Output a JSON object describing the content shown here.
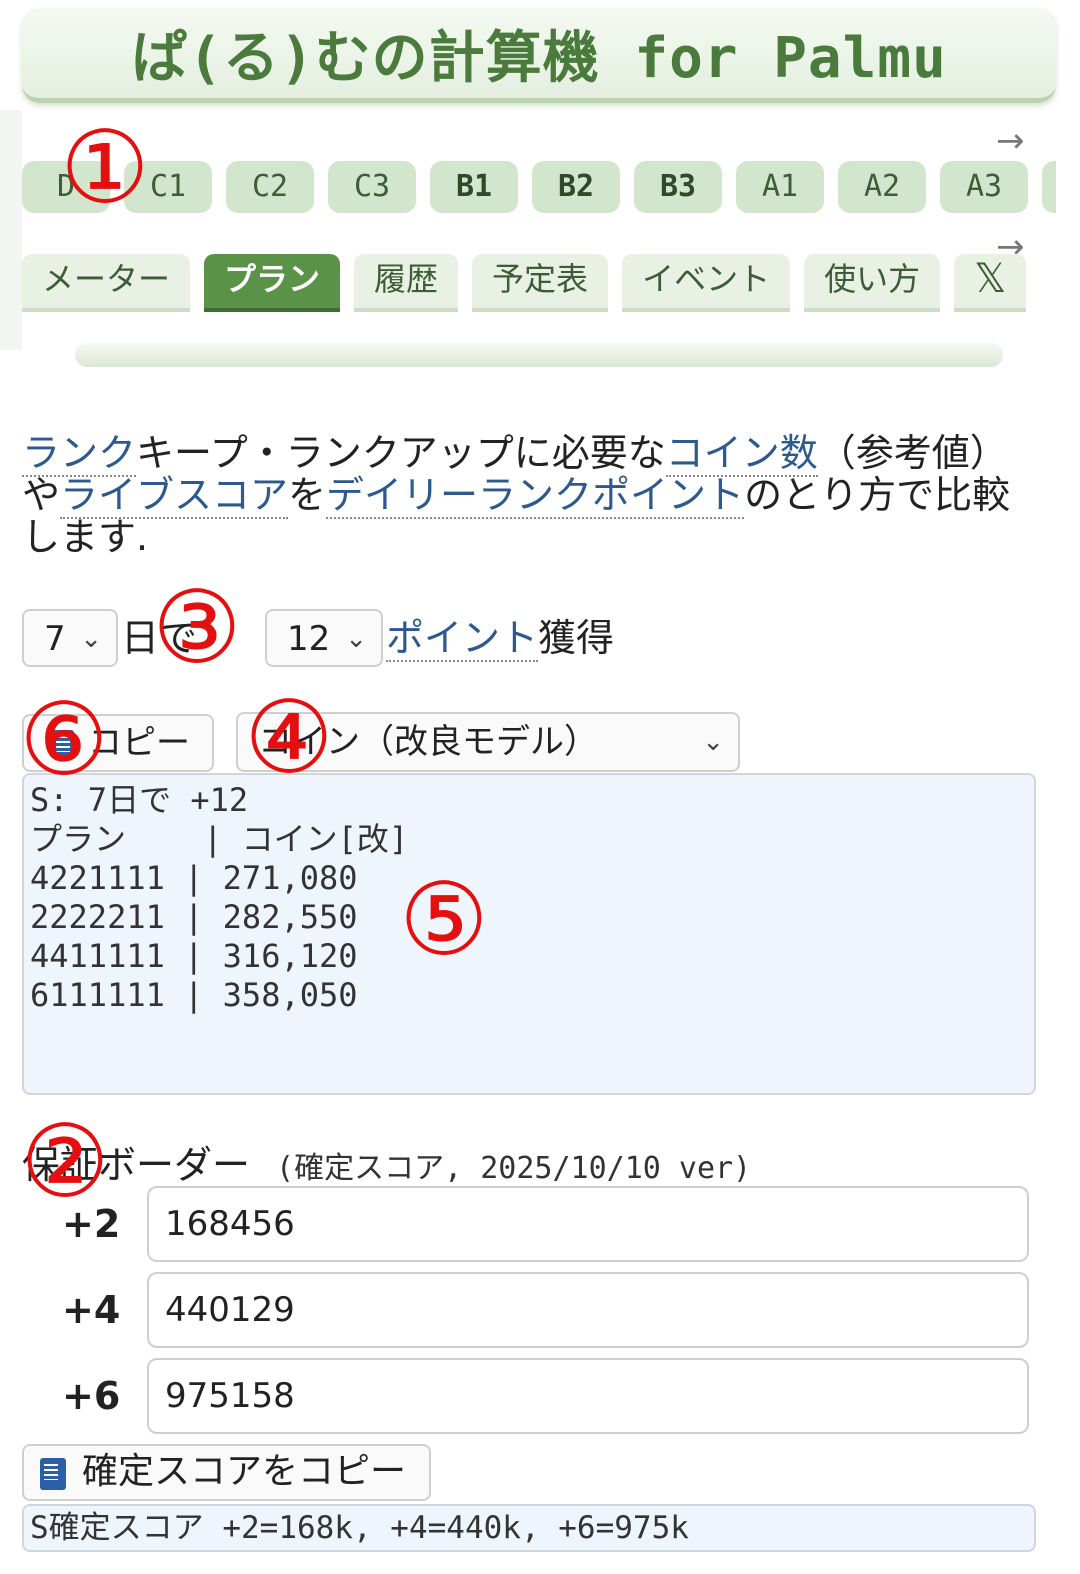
{
  "header": {
    "title": "ぱ(る)むの計算機 for Palmu"
  },
  "nav": {
    "scroll_arrow": "→"
  },
  "ranks": [
    "D",
    "C1",
    "C2",
    "C3",
    "B1",
    "B2",
    "B3",
    "A1",
    "A2",
    "A3",
    ""
  ],
  "tabs": [
    {
      "label": "メーター"
    },
    {
      "label": "プラン"
    },
    {
      "label": "履歴"
    },
    {
      "label": "予定表"
    },
    {
      "label": "イベント"
    },
    {
      "label": "使い方"
    },
    {
      "label": "𝕏"
    }
  ],
  "intro": {
    "link_rank": "ランク",
    "t1": "キープ・ランクアップに必要な",
    "link_coins": "コイン数",
    "t2": "（参考値）や",
    "link_live": "ライブスコア",
    "t3": "を",
    "link_daily": "デイリーランクポイント",
    "t4": "のとり方で比較します."
  },
  "plan": {
    "days_value": "7",
    "days_suffix": "日で",
    "points_value": "12",
    "points_link": "ポイント",
    "points_suffix": "獲得",
    "copy_label": "コピー",
    "metric_value": "コイン（改良モデル）",
    "chevron": "⌄",
    "output": "S: 7日で +12\nプラン    | コイン[改]\n4221111 | 271,080\n2222211 | 282,550\n4411111 | 316,120\n6111111 | 358,050"
  },
  "border": {
    "label": "保証ボーダー",
    "note": "(確定スコア, 2025/10/10 ver)",
    "rows": [
      {
        "plus": "+2",
        "value": "168456"
      },
      {
        "plus": "+4",
        "value": "440129"
      },
      {
        "plus": "+6",
        "value": "975158"
      }
    ],
    "copy_label": "確定スコアをコピー",
    "summary": "S確定スコア +2=168k, +4=440k, +6=975k"
  },
  "markers": [
    "①",
    "②",
    "③",
    "④",
    "⑤",
    "⑥"
  ],
  "colors": {
    "brand_green": "#4a7a3c",
    "active_tab": "#5a9348",
    "link": "#2c5a8f",
    "marker_red": "#e60f0f"
  }
}
